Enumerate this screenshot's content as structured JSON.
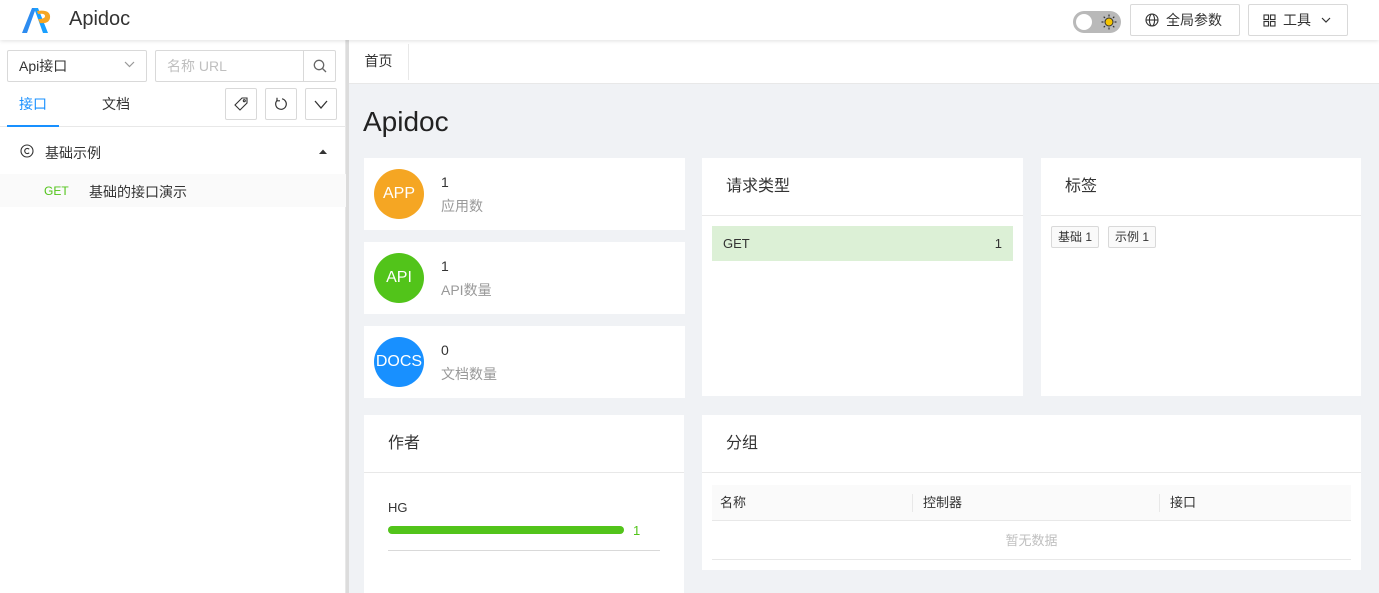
{
  "header": {
    "app_title": "Apidoc",
    "global_params_label": "全局参数",
    "tools_label": "工具"
  },
  "sidebar": {
    "select_value": "Api接口",
    "search_placeholder": "名称 URL",
    "tabs": [
      {
        "label": "接口",
        "active": true
      },
      {
        "label": "文档",
        "active": false
      }
    ],
    "group": {
      "label": "基础示例"
    },
    "items": [
      {
        "method": "GET",
        "name": "基础的接口演示"
      }
    ]
  },
  "main": {
    "page_tab": "首页",
    "title": "Apidoc",
    "stats": [
      {
        "icon_text": "APP",
        "value": "1",
        "label": "应用数",
        "color": "#f5a623"
      },
      {
        "icon_text": "API",
        "value": "1",
        "label": "API数量",
        "color": "#52c41a"
      },
      {
        "icon_text": "DOCS",
        "value": "0",
        "label": "文档数量",
        "color": "#1890ff"
      }
    ],
    "request_types": {
      "title": "请求类型",
      "rows": [
        {
          "method": "GET",
          "count": "1"
        }
      ]
    },
    "tags": {
      "title": "标签",
      "items": [
        "基础 1",
        "示例 1"
      ]
    },
    "authors": {
      "title": "作者",
      "rows": [
        {
          "name": "HG",
          "count": "1",
          "fraction": 1.0
        }
      ]
    },
    "groups": {
      "title": "分组",
      "columns": [
        "名称",
        "控制器",
        "接口"
      ],
      "empty_text": "暂无数据"
    }
  },
  "colors": {
    "accent": "#1890ff",
    "success": "#52c41a",
    "warning": "#f5a623"
  }
}
